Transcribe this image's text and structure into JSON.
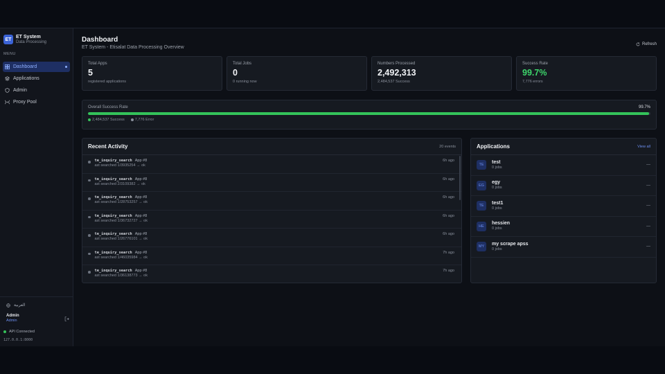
{
  "brand": {
    "logo": "ET",
    "title": "ET System",
    "subtitle": "Data Processing"
  },
  "sidebar": {
    "menu_label": "MENU",
    "items": [
      {
        "label": "Dashboard",
        "icon": "dashboard-icon",
        "active": true
      },
      {
        "label": "Applications",
        "icon": "layers-icon"
      },
      {
        "label": "Admin",
        "icon": "shield-icon"
      },
      {
        "label": "Proxy Pool",
        "icon": "broadcast-icon"
      }
    ],
    "language": "العربية",
    "user": {
      "name": "Admin",
      "role": "Admin"
    },
    "api_status": "API Connected",
    "host": "127.0.0.1:8000"
  },
  "header": {
    "title": "Dashboard",
    "subtitle": "ET System - Etisalat Data Processing Overview",
    "refresh_label": "Refresh"
  },
  "stats": [
    {
      "label": "Total Apps",
      "value": "5",
      "sub": "registered applications"
    },
    {
      "label": "Total Jobs",
      "value": "0",
      "sub": "0 running now"
    },
    {
      "label": "Numbers Processed",
      "value": "2,492,313",
      "sub": "2,484,537 Success"
    },
    {
      "label": "Success Rate",
      "value": "99.7%",
      "sub": "7,776 errors"
    }
  ],
  "success_rate": {
    "label": "Overall Success Rate",
    "percent_label": "99.7%",
    "fill_percent": 99.7,
    "success_legend": "2,484,537 Success",
    "error_legend": "7,776 Error",
    "success_color": "#34c35a",
    "error_color": "#8a909c"
  },
  "activity": {
    "title": "Recent Activity",
    "meta": "20 events",
    "rows": [
      {
        "name": "te_inquiry_search",
        "app": "App #8",
        "detail": "ast searched 1/3935254 → ok",
        "time": "6h ago"
      },
      {
        "name": "te_inquiry_search",
        "app": "App #8",
        "detail": "ast searched 2/3109382 → ok",
        "time": "6h ago"
      },
      {
        "name": "te_inquiry_search",
        "app": "App #8",
        "detail": "ast searched 1/28753257 → ok",
        "time": "6h ago"
      },
      {
        "name": "te_inquiry_search",
        "app": "App #8",
        "detail": "ast searched 1/36732727 → ok",
        "time": "6h ago"
      },
      {
        "name": "te_inquiry_search",
        "app": "App #8",
        "detail": "ast searched 1/26776101 → ok",
        "time": "6h ago"
      },
      {
        "name": "te_inquiry_search",
        "app": "App #8",
        "detail": "ast searched 1/46035984 → ok",
        "time": "7h ago"
      },
      {
        "name": "te_inquiry_search",
        "app": "App #8",
        "detail": "ast searched 1/36138773 → ok",
        "time": "7h ago"
      }
    ]
  },
  "applications": {
    "title": "Applications",
    "view_all": "View all",
    "rows": [
      {
        "initials": "TE",
        "name": "test",
        "jobs": "0 jobs",
        "trailing": "—"
      },
      {
        "initials": "EG",
        "name": "egy",
        "jobs": "0 jobs",
        "trailing": "—"
      },
      {
        "initials": "TE",
        "name": "test1",
        "jobs": "0 jobs",
        "trailing": "—"
      },
      {
        "initials": "HE",
        "name": "hessien",
        "jobs": "0 jobs",
        "trailing": "—"
      },
      {
        "initials": "MY",
        "name": "my scrape apss",
        "jobs": "0 jobs",
        "trailing": "—"
      }
    ]
  }
}
